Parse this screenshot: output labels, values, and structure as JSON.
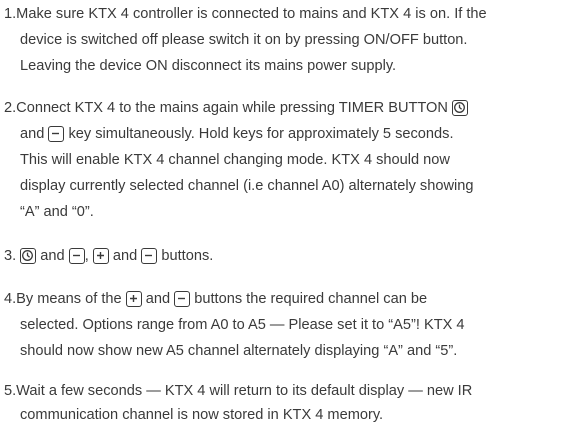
{
  "steps": [
    {
      "num": "1.",
      "lines": [
        "Make sure KTX 4 controller is connected to mains and KTX 4 is on. If the",
        "device is switched off please switch it on by pressing ON/OFF button.",
        "Leaving the device ON disconnect its mains power supply."
      ]
    },
    {
      "num": "2.",
      "l1": "Connect KTX 4 to the mains again while pressing TIMER BUTTON",
      "l2a": "and",
      "l2b": "key simultaneously. Hold keys for approximately 5 seconds.",
      "l3": "This will enable KTX 4 channel changing mode. KTX 4 should now",
      "l4": "display currently selected channel (i.e channel A0) alternately showing",
      "l5": "“A” and “0”."
    },
    {
      "num": "3.",
      "and1": "and",
      "comma": ",",
      "and2": "and",
      "and3": "and",
      "tail": "buttons."
    },
    {
      "num": "4.",
      "l1a": "By means of the",
      "l1b": "and",
      "l1c": "buttons the required channel can be",
      "l2": "selected. Options range from A0 to A5 — Please set it to “A5”! KTX 4",
      "l3": "should now show new A5 channel alternately displaying “A” and “5”."
    },
    {
      "num": "5.",
      "l1": "Wait a few seconds — KTX 4 will return to its default display — new IR",
      "l2": "communication channel is now stored in KTX 4 memory."
    }
  ],
  "icons": {
    "timer": "timer-icon",
    "minus": "minus-key-icon",
    "plus": "plus-key-icon"
  }
}
